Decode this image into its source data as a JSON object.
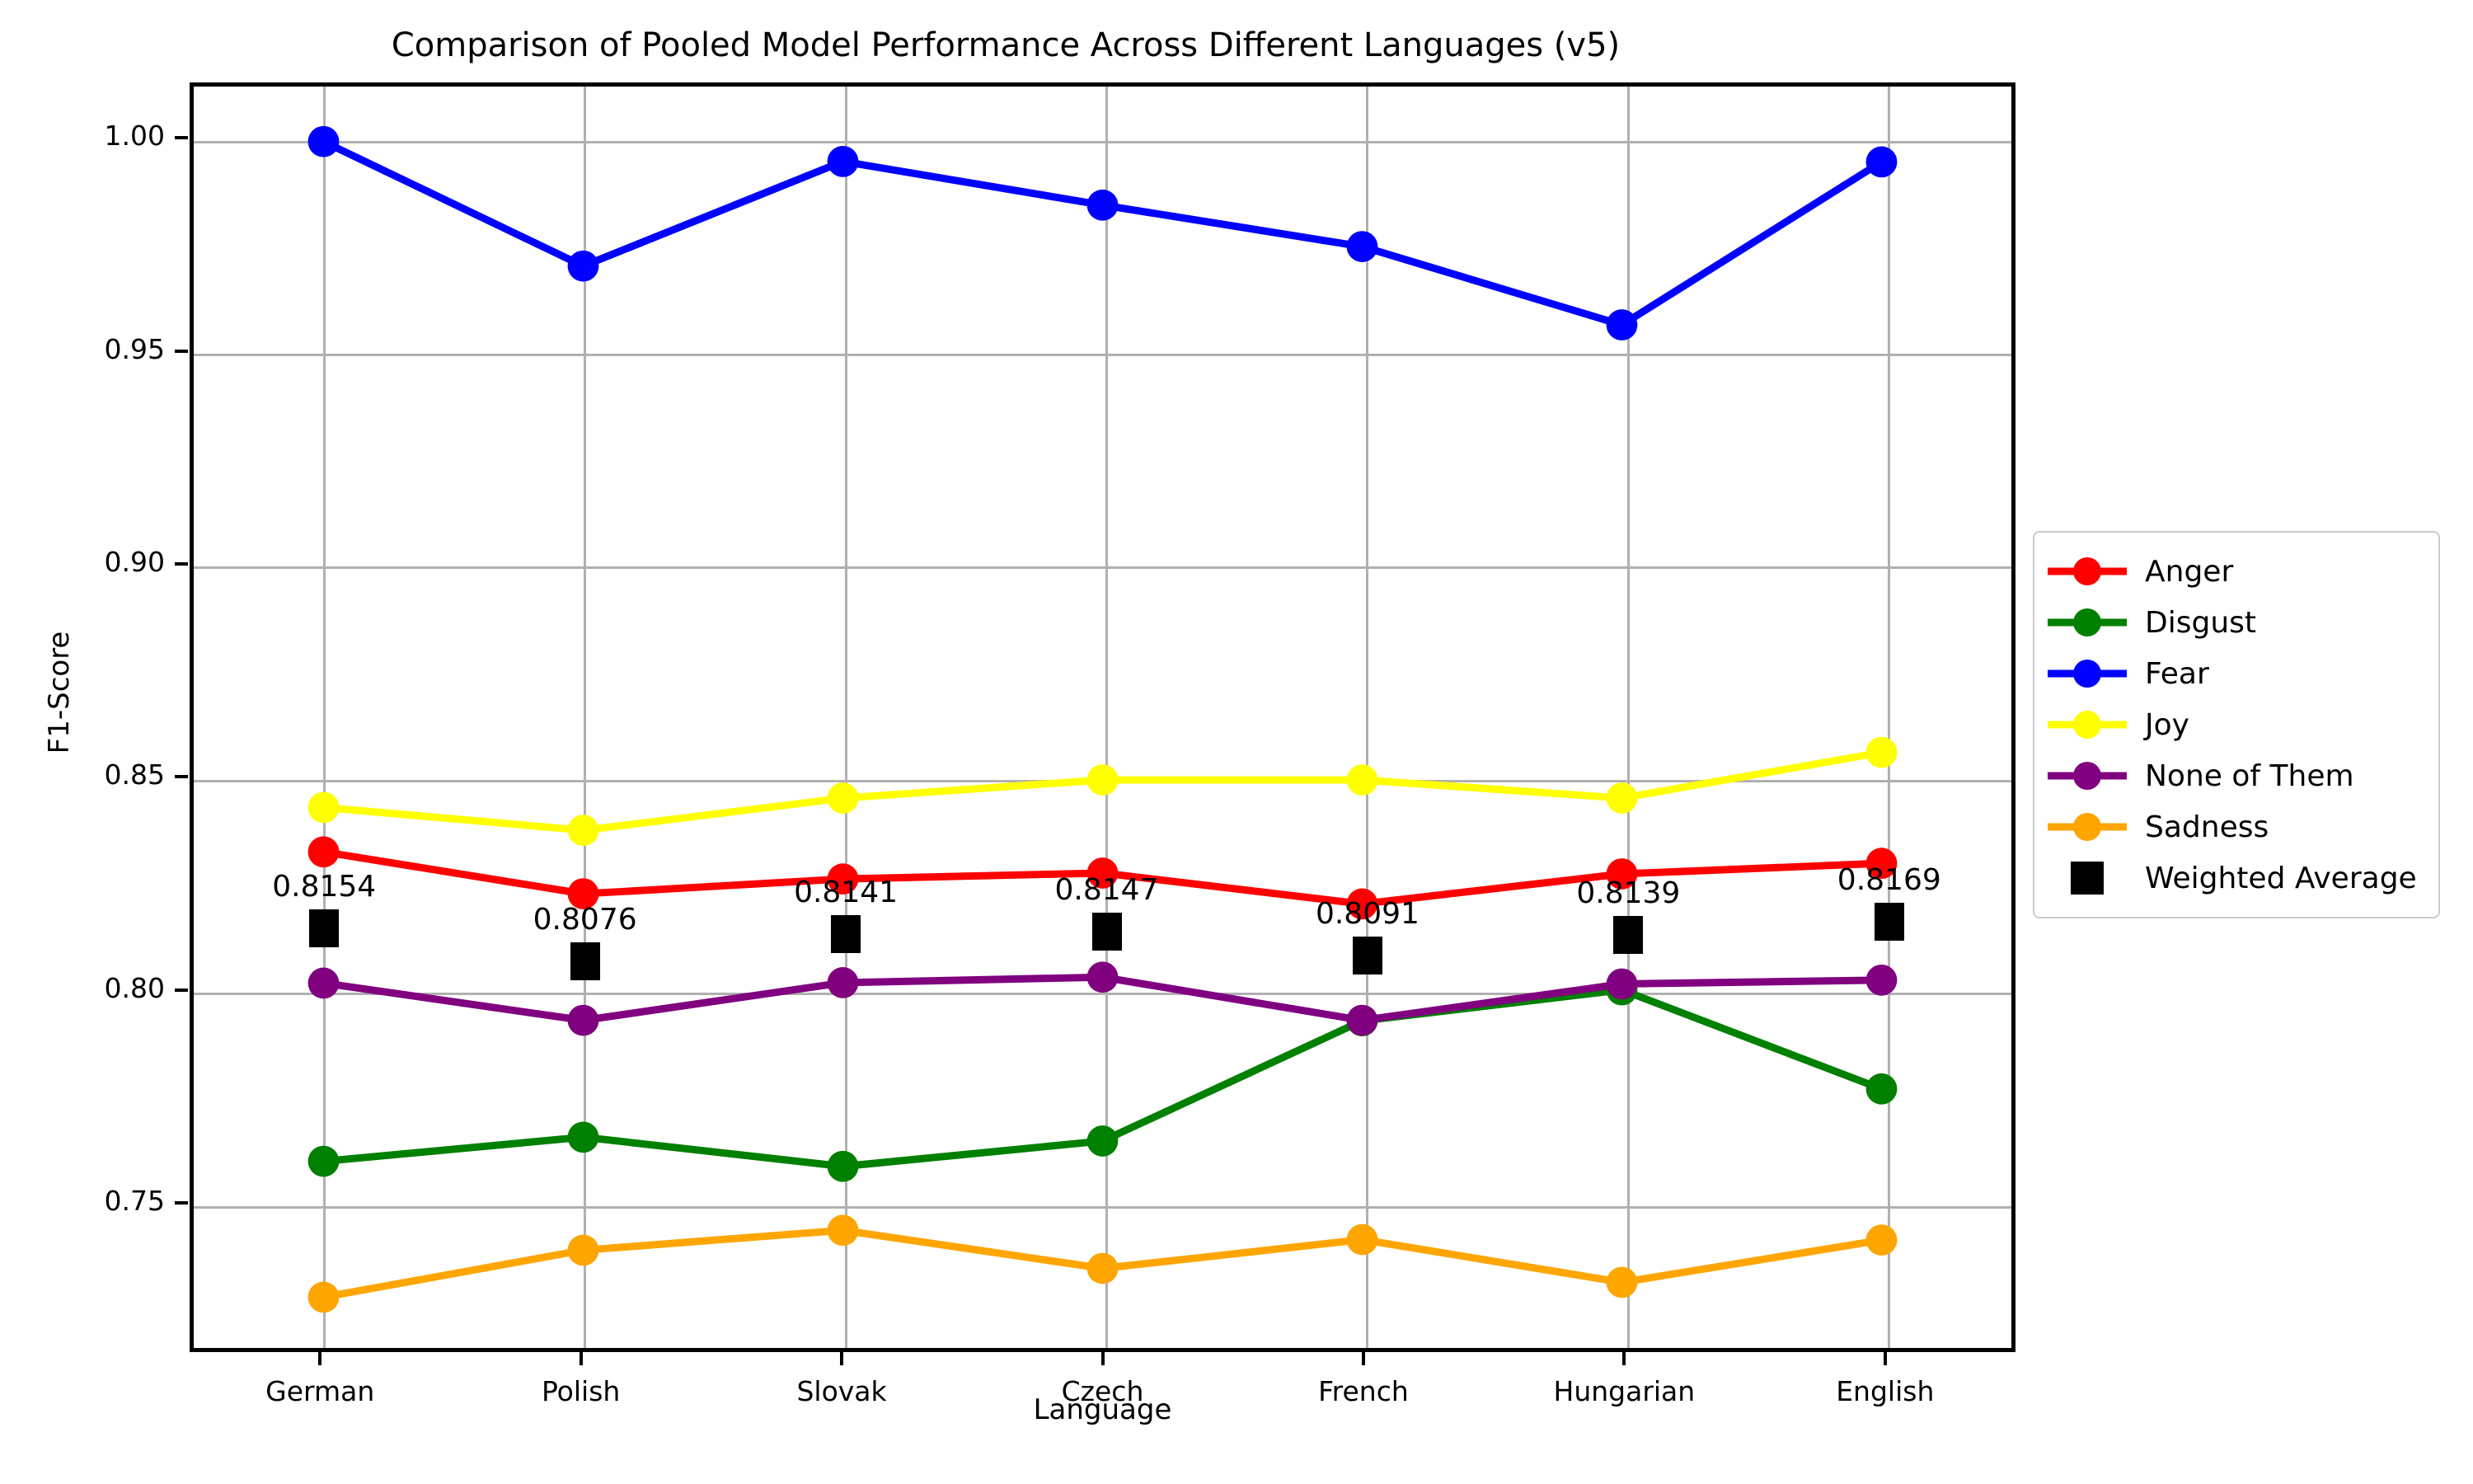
{
  "chart_data": {
    "type": "line",
    "title": "Comparison of Pooled Model Performance Across Different Languages (v5)",
    "xlabel": "Language",
    "ylabel": "F1-Score",
    "categories": [
      "German",
      "Polish",
      "Slovak",
      "Czech",
      "French",
      "Hungarian",
      "English"
    ],
    "ylim": [
      0.715,
      1.013
    ],
    "yticks": [
      "1.00",
      "0.95",
      "0.90",
      "0.85",
      "0.80",
      "0.75"
    ],
    "ytick_values": [
      1.0,
      0.95,
      0.9,
      0.85,
      0.8,
      0.75
    ],
    "grid": true,
    "legend_position": "outside right",
    "series": [
      {
        "name": "Anger",
        "color": "#ff0000",
        "marker": "circle",
        "values": [
          0.8322,
          0.8223,
          0.8258,
          0.8272,
          0.8199,
          0.827,
          0.8295
        ]
      },
      {
        "name": "Disgust",
        "color": "#008000",
        "marker": "circle",
        "values": [
          0.7591,
          0.7648,
          0.7579,
          0.7639,
          0.7923,
          0.7996,
          0.7762
        ]
      },
      {
        "name": "Fear",
        "color": "#0000ff",
        "marker": "circle",
        "values": [
          1.0,
          0.9706,
          0.9953,
          0.985,
          0.9752,
          0.9567,
          0.9952
        ]
      },
      {
        "name": "Joy",
        "color": "#ffff00",
        "marker": "circle",
        "values": [
          0.8427,
          0.8373,
          0.8449,
          0.8492,
          0.8492,
          0.8449,
          0.8557
        ]
      },
      {
        "name": "None of Them",
        "color": "#800080",
        "marker": "circle",
        "values": [
          0.8012,
          0.7924,
          0.8013,
          0.8026,
          0.7924,
          0.801,
          0.8019
        ]
      },
      {
        "name": "Sadness",
        "color": "#ffa500",
        "marker": "circle",
        "values": [
          0.727,
          0.7381,
          0.7428,
          0.7338,
          0.7406,
          0.7305,
          0.7405
        ]
      }
    ],
    "weighted_average": {
      "name": "Weighted Average",
      "color": "#000000",
      "marker": "square",
      "values": [
        0.8154,
        0.8076,
        0.8141,
        0.8147,
        0.8091,
        0.8139,
        0.8169
      ],
      "labels": [
        "0.8154",
        "0.8076",
        "0.8141",
        "0.8147",
        "0.8091",
        "0.8139",
        "0.8169"
      ]
    }
  },
  "legend": {
    "entries": [
      {
        "label": "Anger",
        "color": "#ff0000",
        "kind": "line"
      },
      {
        "label": "Disgust",
        "color": "#008000",
        "kind": "line"
      },
      {
        "label": "Fear",
        "color": "#0000ff",
        "kind": "line"
      },
      {
        "label": "Joy",
        "color": "#ffff00",
        "kind": "line"
      },
      {
        "label": "None of Them",
        "color": "#800080",
        "kind": "line"
      },
      {
        "label": "Sadness",
        "color": "#ffa500",
        "kind": "line"
      },
      {
        "label": "Weighted Average",
        "color": "#000000",
        "kind": "square"
      }
    ]
  }
}
